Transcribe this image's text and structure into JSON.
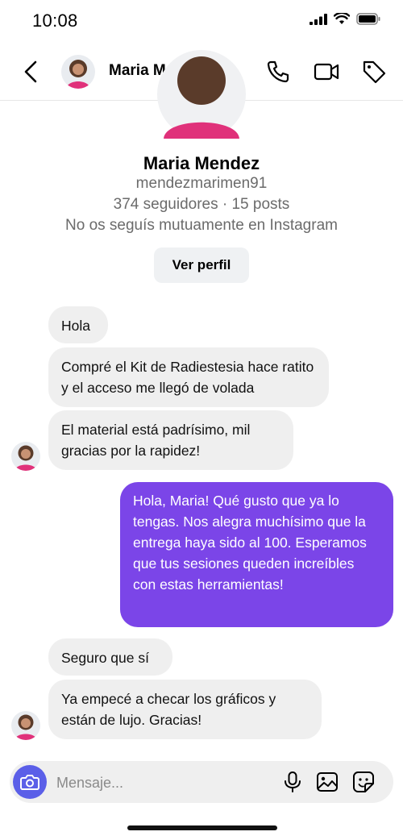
{
  "status": {
    "time": "10:08"
  },
  "header": {
    "name": "Maria Mendez",
    "chevron": "›"
  },
  "profile": {
    "name": "Maria Mendez",
    "username": "mendezmarimen91",
    "stats": "374 seguidores · 15 posts",
    "mutual": "No os seguís mutuamente en Instagram",
    "view_button": "Ver perfil"
  },
  "messages": [
    {
      "from": "them",
      "text": "Hola"
    },
    {
      "from": "them",
      "text": "Compré el Kit de Radiestesia hace ratito y el acceso me llegó de volada"
    },
    {
      "from": "them",
      "text": " El material está padrísimo, mil gracias por la rapidez!"
    },
    {
      "from": "me",
      "text": "Hola, Maria! Qué gusto que ya lo tengas. Nos alegra muchísimo que la entrega haya sido al 100. Esperamos que tus sesiones queden increíbles con estas herramientas!"
    },
    {
      "from": "them",
      "text": "Seguro que sí"
    },
    {
      "from": "them",
      "text": " Ya empecé a checar los gráficos y están de lujo. Gracias!"
    }
  ],
  "composer": {
    "placeholder": "Mensaje..."
  },
  "colors": {
    "outgoing": "#7b45e8",
    "incoming": "#efefef",
    "camera": "#5b5fe8"
  },
  "icons": [
    "back-arrow-icon",
    "phone-icon",
    "video-icon",
    "tag-icon",
    "camera-icon",
    "microphone-icon",
    "gallery-icon",
    "sticker-icon"
  ]
}
